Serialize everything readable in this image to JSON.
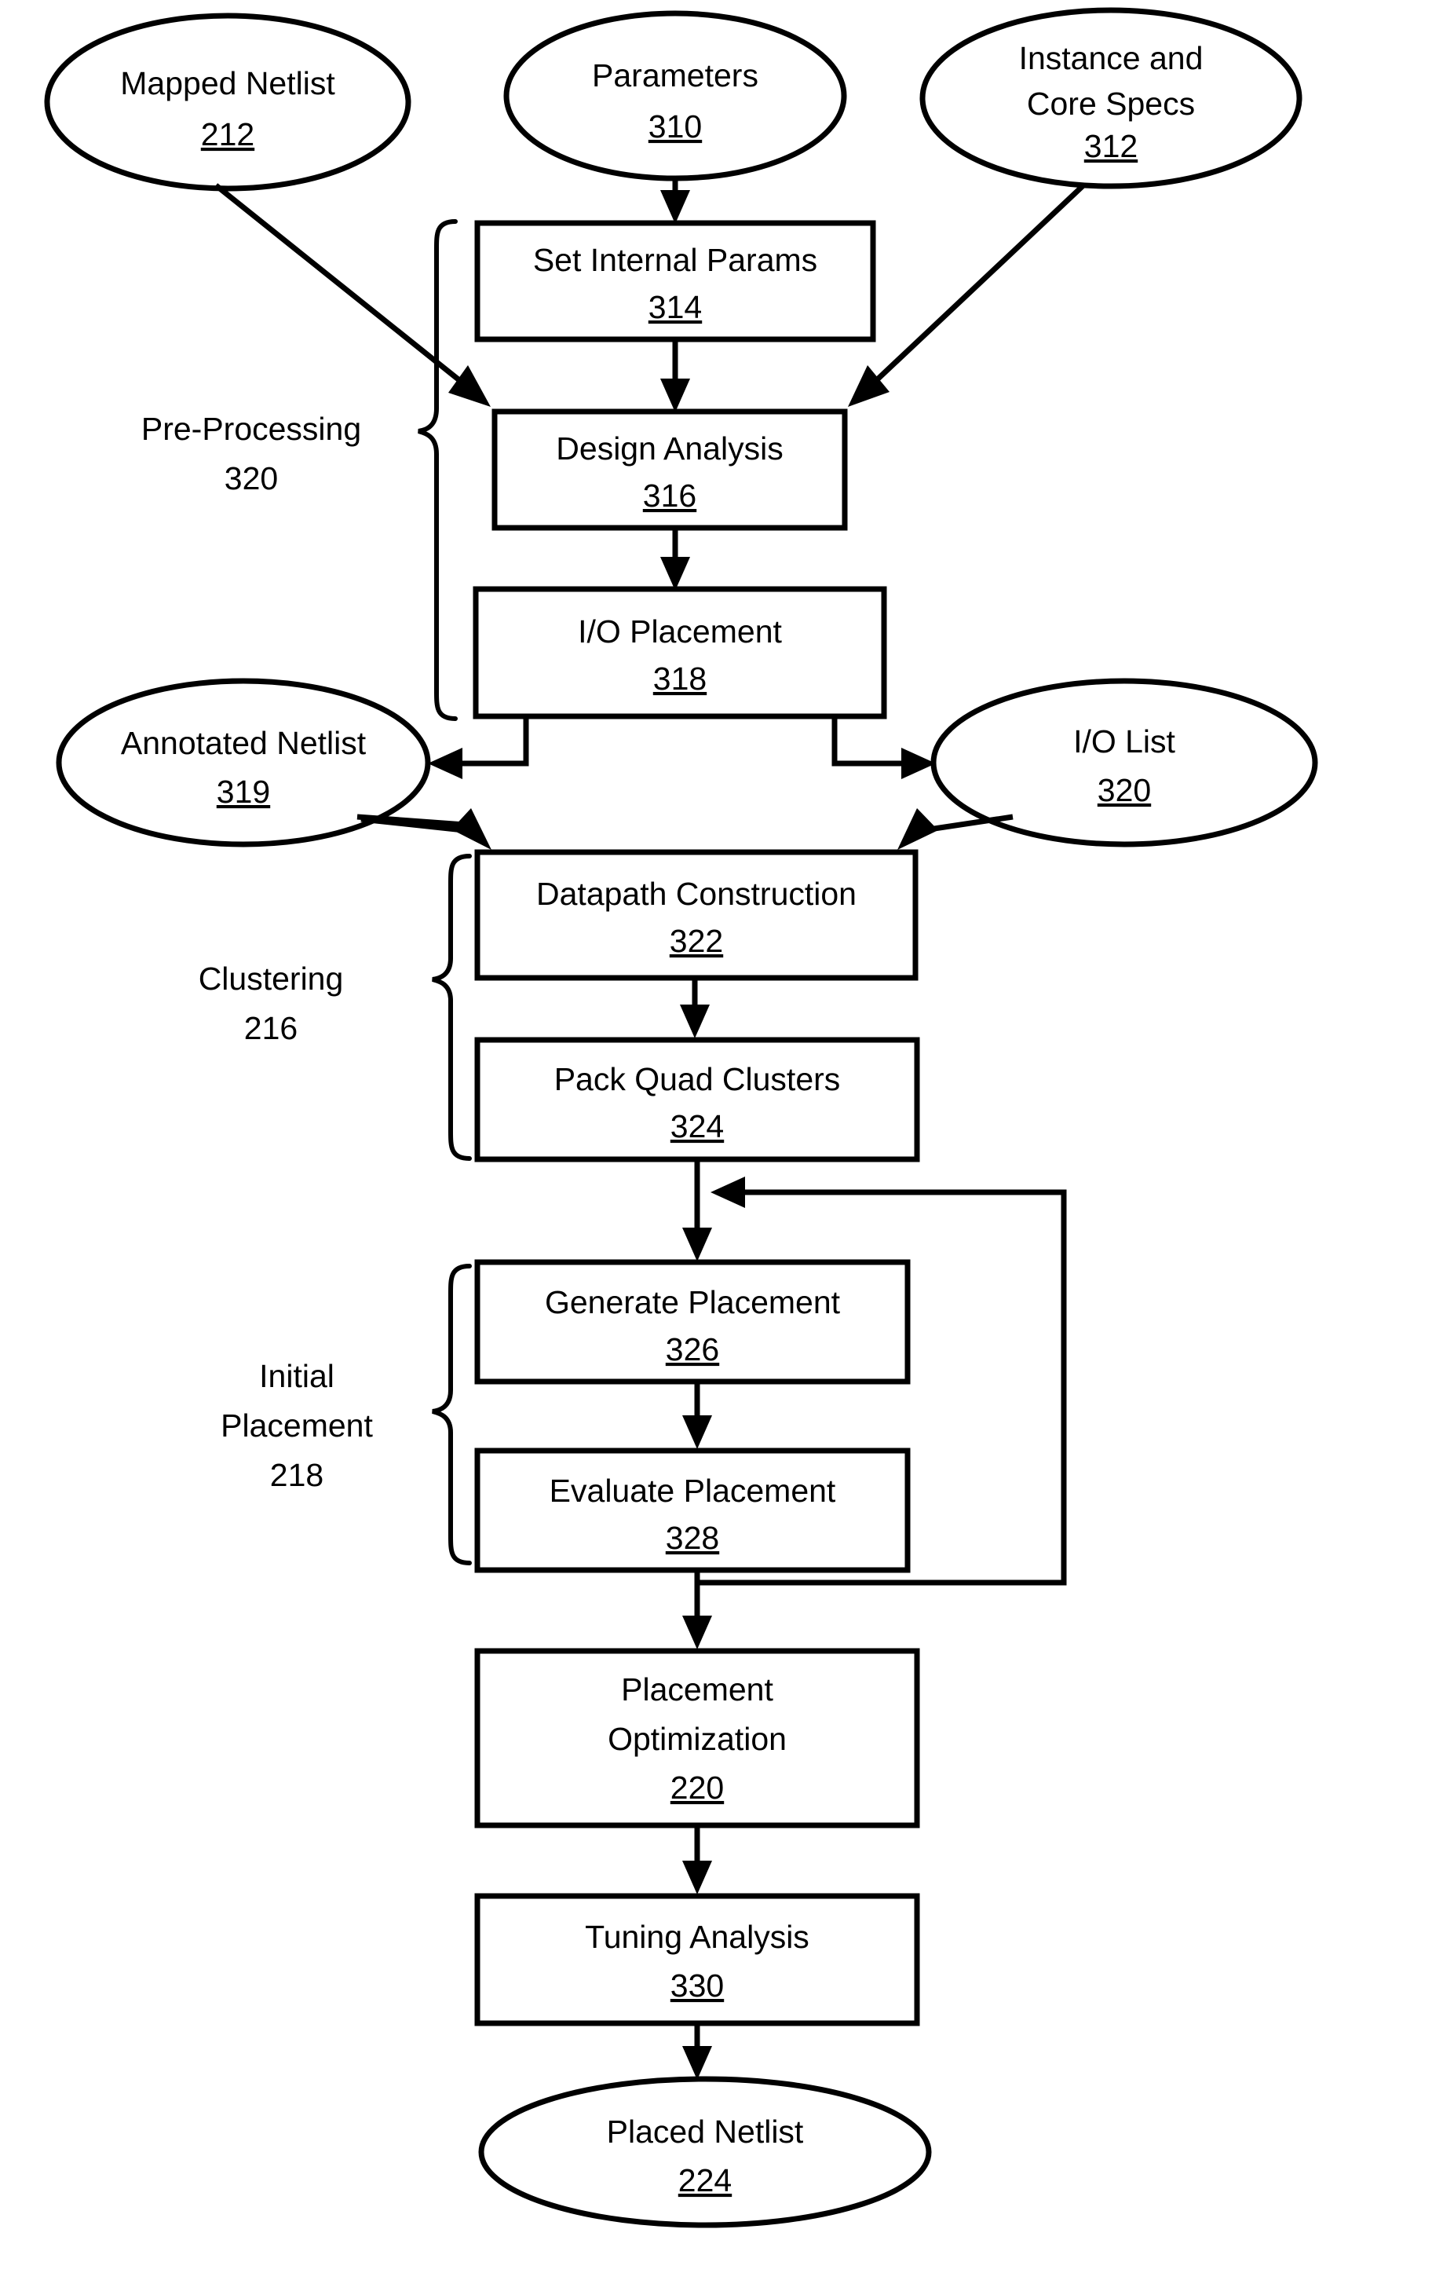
{
  "figure": {
    "type": "patent-flowchart",
    "title": "Placement flow diagram"
  },
  "nodes": {
    "mapped_netlist": {
      "label": "Mapped Netlist",
      "ref": "212",
      "shape": "ellipse"
    },
    "parameters": {
      "label": "Parameters",
      "ref": "310",
      "shape": "ellipse"
    },
    "instance_core_specs_line1": {
      "label": "Instance and",
      "ref": "312",
      "shape": "ellipse"
    },
    "instance_core_specs_line2": {
      "label": "Core Specs"
    },
    "set_internal_params": {
      "label": "Set Internal Params",
      "ref": "314",
      "shape": "rect"
    },
    "design_analysis": {
      "label": "Design Analysis",
      "ref": "316",
      "shape": "rect"
    },
    "io_placement": {
      "label": "I/O Placement",
      "ref": "318",
      "shape": "rect"
    },
    "annotated_netlist": {
      "label": "Annotated Netlist",
      "ref": "319",
      "shape": "ellipse"
    },
    "io_list": {
      "label": "I/O List",
      "ref": "320",
      "shape": "ellipse"
    },
    "datapath_construction": {
      "label": "Datapath Construction",
      "ref": "322",
      "shape": "rect"
    },
    "pack_quad_clusters": {
      "label": "Pack Quad Clusters",
      "ref": "324",
      "shape": "rect"
    },
    "generate_placement": {
      "label": "Generate Placement",
      "ref": "326",
      "shape": "rect"
    },
    "evaluate_placement": {
      "label": "Evaluate Placement",
      "ref": "328",
      "shape": "rect"
    },
    "placement_optimization_line1": {
      "label": "Placement",
      "ref": "220",
      "shape": "rect"
    },
    "placement_optimization_line2": {
      "label": "Optimization"
    },
    "tuning_analysis": {
      "label": "Tuning Analysis",
      "ref": "330",
      "shape": "rect"
    },
    "placed_netlist": {
      "label": "Placed Netlist",
      "ref": "224",
      "shape": "ellipse"
    }
  },
  "groups": {
    "preprocessing": {
      "label": "Pre-Processing",
      "ref": "320"
    },
    "clustering": {
      "label": "Clustering",
      "ref": "216"
    },
    "initial_placement_line1": {
      "label": "Initial",
      "ref": "218"
    },
    "initial_placement_line2": {
      "label": "Placement"
    }
  },
  "colors": {
    "stroke": "#000000",
    "fill": "#ffffff",
    "background": "#ffffff"
  }
}
